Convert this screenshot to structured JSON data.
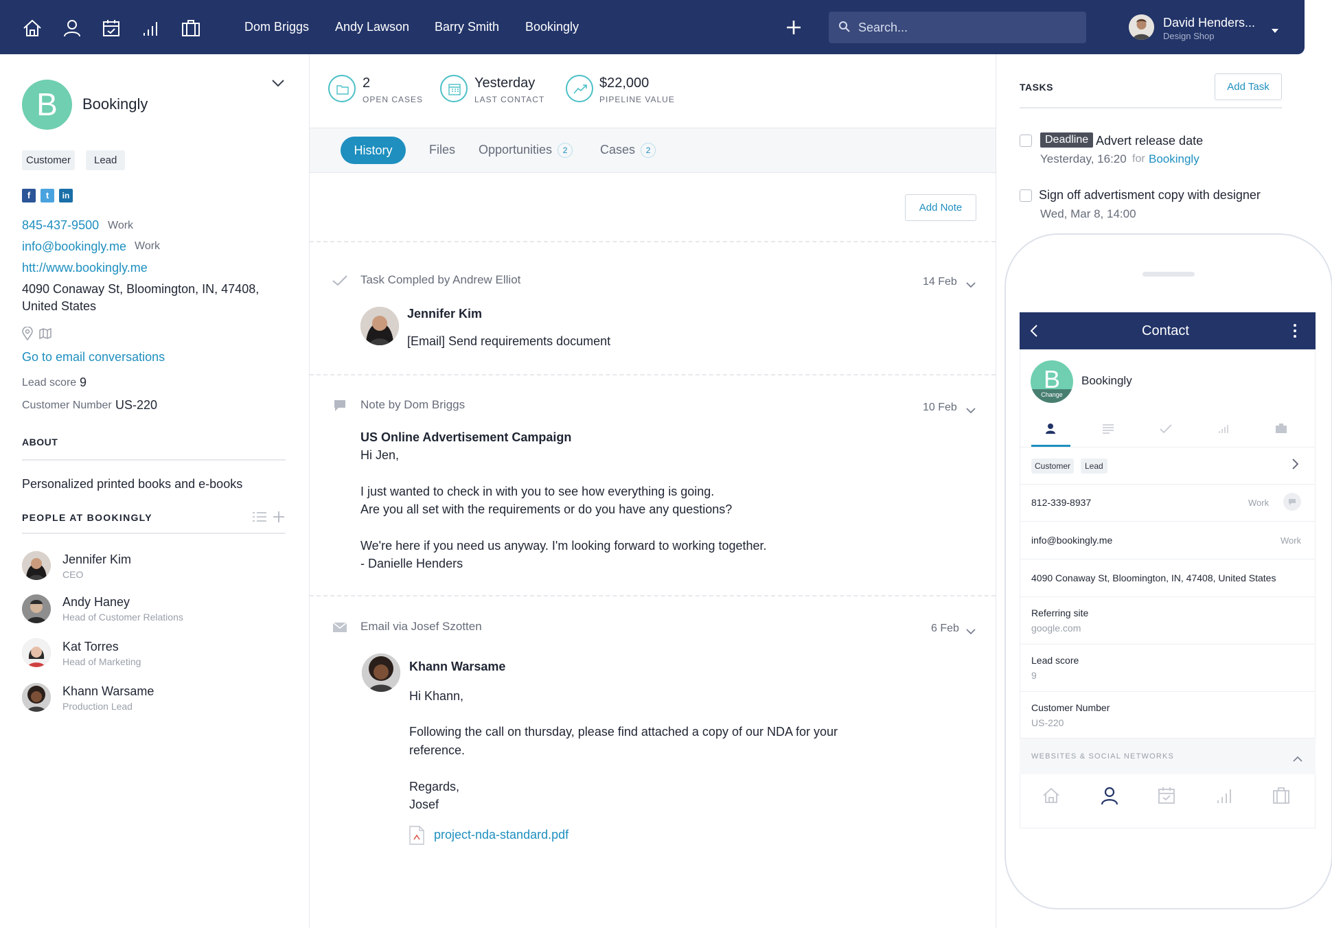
{
  "nav": {
    "links": [
      "Dom Briggs",
      "Andy Lawson",
      "Barry Smith",
      "Bookingly"
    ],
    "search_placeholder": "Search...",
    "user_name": "David Henders...",
    "user_company": "Design Shop"
  },
  "company": {
    "initial": "B",
    "name": "Bookingly",
    "tags": [
      "Customer",
      "Lead"
    ],
    "social": [
      "f",
      "t",
      "in"
    ],
    "phone": "845-437-9500",
    "phone_type": "Work",
    "email": "info@bookingly.me",
    "email_type": "Work",
    "website": "htt://www.bookingly.me",
    "address_line1": "4090 Conaway St, Bloomington, IN, 47408,",
    "address_line2": "United States",
    "email_conversations": "Go to email conversations",
    "lead_score_label": "Lead score",
    "lead_score": "9",
    "customer_number_label": "Customer Number",
    "customer_number": "US-220",
    "about_heading": "ABOUT",
    "about": "Personalized printed books and e-books",
    "people_heading": "PEOPLE AT BOOKINGLY",
    "people": [
      {
        "name": "Jennifer Kim",
        "title": "CEO"
      },
      {
        "name": "Andy Haney",
        "title": "Head of Customer Relations"
      },
      {
        "name": "Kat Torres",
        "title": "Head of Marketing"
      },
      {
        "name": "Khann Warsame",
        "title": "Production Lead"
      }
    ]
  },
  "stats": [
    {
      "value": "2",
      "label": "OPEN CASES"
    },
    {
      "value": "Yesterday",
      "label": "LAST CONTACT"
    },
    {
      "value": "$22,000",
      "label": "PIPELINE VALUE"
    }
  ],
  "tabs": [
    {
      "label": "History",
      "count": ""
    },
    {
      "label": "Files",
      "count": ""
    },
    {
      "label": "Opportunities",
      "count": "2"
    },
    {
      "label": "Cases",
      "count": "2"
    }
  ],
  "add_note": "Add Note",
  "history": [
    {
      "header": "Task Compled by Andrew Elliot",
      "date": "14 Feb",
      "person": "Jennifer Kim",
      "lines": [
        "[Email] Send requirements document"
      ]
    },
    {
      "header": "Note by Dom Briggs",
      "date": "10 Feb",
      "title": "US Online Advertisement Campaign",
      "lines": [
        "Hi Jen,",
        "I just wanted to check in with you to see how everything is going.",
        "Are you all set with the requirements or do you have any questions?",
        "We're here if you need us anyway. I'm looking forward to working together.",
        "- Danielle Henders"
      ]
    },
    {
      "header": "Email via Josef Szotten",
      "date": "6 Feb",
      "person": "Khann Warsame",
      "lines": [
        "Hi Khann,",
        "Following the call on thursday, please find attached a copy of our NDA for your",
        "reference.",
        "Regards,",
        "Josef"
      ],
      "attachment": "project-nda-standard.pdf"
    }
  ],
  "tasks": {
    "heading": "TASKS",
    "add_label": "Add Task",
    "items": [
      {
        "badge": "Deadline",
        "title": "Advert release date",
        "when": "Yesterday, 16:20",
        "for_word": "for",
        "for_link": "Bookingly"
      },
      {
        "badge": "",
        "title": "Sign off advertisment copy with designer",
        "when": "Wed, Mar 8, 14:00",
        "for_word": "",
        "for_link": ""
      }
    ]
  },
  "mobile": {
    "title": "Contact",
    "initial": "B",
    "change_label": "Change",
    "company": "Bookingly",
    "tags": [
      "Customer",
      "Lead"
    ],
    "phone": "812-339-8937",
    "phone_type": "Work",
    "email": "info@bookingly.me",
    "email_type": "Work",
    "address": "4090 Conaway St, Bloomington, IN, 47408, United States",
    "fields": [
      {
        "label": "Referring site",
        "value": "google.com"
      },
      {
        "label": "Lead score",
        "value": "9"
      },
      {
        "label": "Customer Number",
        "value": "US-220"
      }
    ],
    "section": "WEBSITES & SOCIAL NETWORKS"
  },
  "colors": {
    "nav": "#223468",
    "accent": "#1e8fbf",
    "avatar_b": "#6fcfb0"
  }
}
